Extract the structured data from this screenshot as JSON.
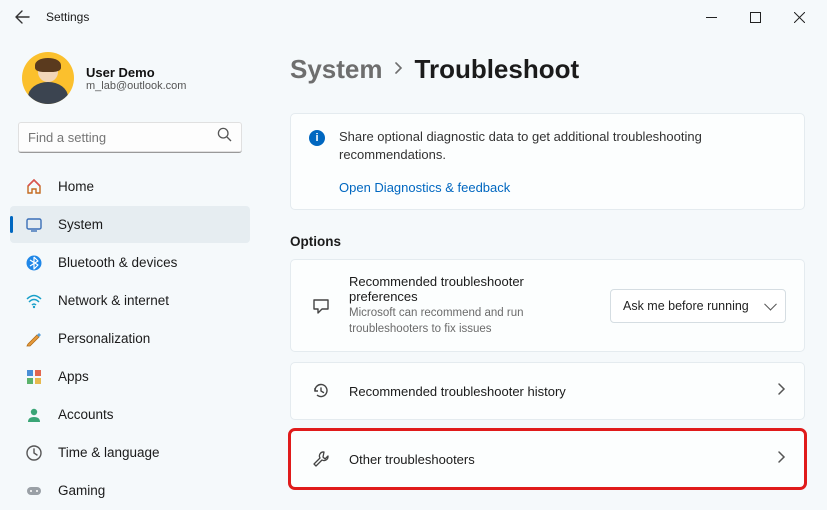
{
  "window": {
    "title": "Settings"
  },
  "profile": {
    "name": "User Demo",
    "email": "m_lab@outlook.com"
  },
  "search": {
    "placeholder": "Find a setting"
  },
  "sidebar": {
    "items": [
      {
        "label": "Home",
        "icon": "home"
      },
      {
        "label": "System",
        "icon": "system"
      },
      {
        "label": "Bluetooth & devices",
        "icon": "bluetooth"
      },
      {
        "label": "Network & internet",
        "icon": "network"
      },
      {
        "label": "Personalization",
        "icon": "personalization"
      },
      {
        "label": "Apps",
        "icon": "apps"
      },
      {
        "label": "Accounts",
        "icon": "accounts"
      },
      {
        "label": "Time & language",
        "icon": "time"
      },
      {
        "label": "Gaming",
        "icon": "gaming"
      }
    ]
  },
  "breadcrumb": {
    "parent": "System",
    "current": "Troubleshoot"
  },
  "info_card": {
    "text": "Share optional diagnostic data to get additional troubleshooting recommendations.",
    "link": "Open Diagnostics & feedback"
  },
  "options": {
    "heading": "Options",
    "pref": {
      "title": "Recommended troubleshooter preferences",
      "sub": "Microsoft can recommend and run troubleshooters to fix issues",
      "dropdown_value": "Ask me before running"
    },
    "history": {
      "title": "Recommended troubleshooter history"
    },
    "other": {
      "title": "Other troubleshooters"
    }
  }
}
